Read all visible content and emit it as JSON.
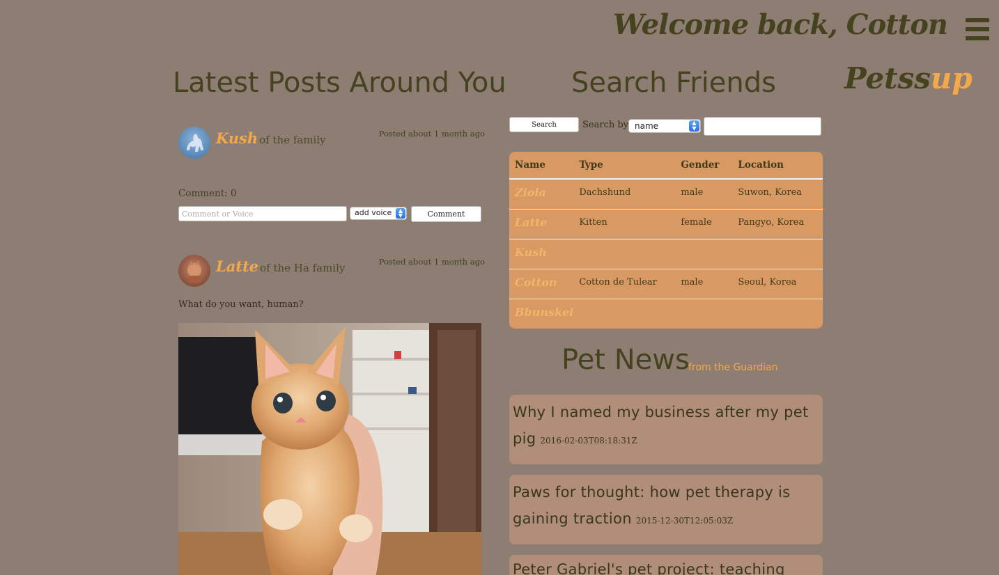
{
  "header": {
    "welcome": "Welcome back, Cotton",
    "menu_icon": "hamburger-menu-icon"
  },
  "brand": {
    "main": "Petss",
    "accent": "up",
    "accent_color": "#f3a94a"
  },
  "posts_section": {
    "title": "Latest Posts Around You",
    "posts": [
      {
        "pet_name": "Kush",
        "family": "of the family",
        "posted": "Posted about 1 month ago",
        "comment_count": "Comment: 0",
        "comment_placeholder": "Comment or Voice",
        "voice_select": "add voice",
        "comment_button": "Comment"
      },
      {
        "pet_name": "Latte",
        "family": "of the Ha family",
        "posted": "Posted about 1 month ago",
        "text": "What do you want, human?"
      }
    ]
  },
  "friends_section": {
    "title": "Search Friends",
    "search_button": "Search",
    "search_by_label": "Search by",
    "search_by_value": "name",
    "columns": [
      "Name",
      "Type",
      "Gender",
      "Location"
    ],
    "rows": [
      [
        "Ziola",
        "Dachshund",
        "male",
        "Suwon, Korea"
      ],
      [
        "Latte",
        "Kitten",
        "female",
        "Pangyo, Korea"
      ],
      [
        "Kush",
        "",
        "",
        ""
      ],
      [
        "Cotton",
        "Cotton de Tulear",
        "male",
        "Seoul, Korea"
      ],
      [
        "Bbunskei",
        "",
        "",
        ""
      ]
    ]
  },
  "news_section": {
    "title": "Pet News",
    "subtitle": "from the Guardian",
    "items": [
      {
        "title": "Why I named my business after my pet pig",
        "date": "2016-02-03T08:18:31Z"
      },
      {
        "title": "Paws for thought: how pet therapy is gaining traction",
        "date": "2015-12-30T12:05:03Z"
      },
      {
        "title": "Peter Gabriel's pet project: teaching",
        "date": ""
      }
    ]
  },
  "colors": {
    "background": "#8e7d72",
    "heading": "#45421f",
    "accent": "#f3a94a",
    "table": "#d89a62",
    "card": "#b08e79"
  }
}
